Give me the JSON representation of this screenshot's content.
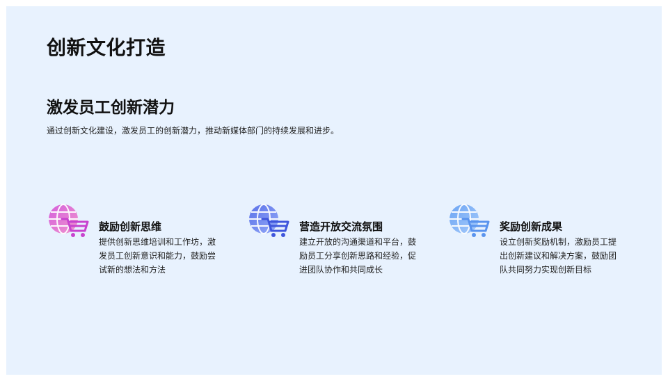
{
  "page_title": "创新文化打造",
  "section": {
    "title": "激发员工创新潜力",
    "description": "通过创新文化建设，激发员工的创新潜力，推动新媒体部门的持续发展和进步。"
  },
  "cards": [
    {
      "title": "鼓励创新思维",
      "description": "提供创新思维培训和工作坊，激发员工创新意识和能力，鼓励尝试新的想法和方法",
      "icon": "globe-cart-icon",
      "icon_colors": [
        "#d24fd8",
        "#f08ac8"
      ]
    },
    {
      "title": "营造开放交流氛围",
      "description": "建立开放的沟通渠道和平台，鼓励员工分享创新思路和经验，促进团队协作和共同成长",
      "icon": "globe-cart-icon",
      "icon_colors": [
        "#4b63e6",
        "#8aa2f7"
      ]
    },
    {
      "title": "奖励创新成果",
      "description": "设立创新奖励机制，激励员工提出创新建议和解决方案，鼓励团队共同努力实现创新目标",
      "icon": "globe-cart-icon",
      "icon_colors": [
        "#5f9cf2",
        "#9fc7fb"
      ]
    }
  ],
  "colors": {
    "background": "#e8f2fe",
    "text": "#111111"
  }
}
